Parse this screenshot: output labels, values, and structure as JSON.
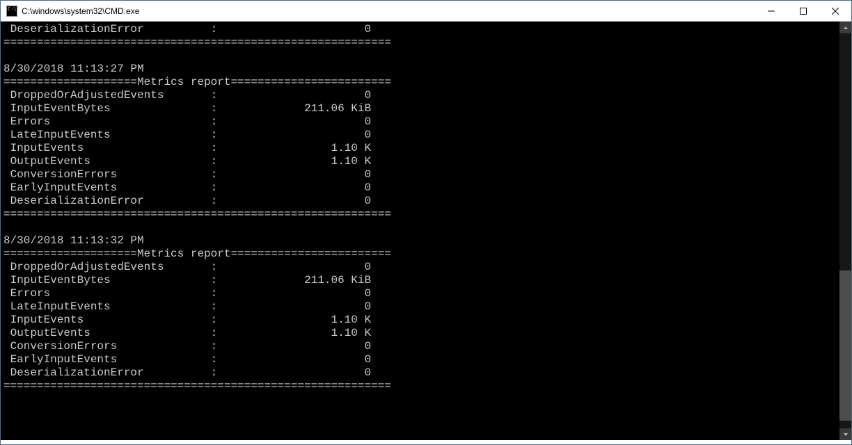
{
  "window": {
    "title": "C:\\windows\\system32\\CMD.exe"
  },
  "separator_heavy": "==========================================================",
  "report_header": "====================Metrics report========================",
  "top_fragment": {
    "label": "DeserializationError",
    "value": "0"
  },
  "reports": [
    {
      "timestamp": "8/30/2018 11:13:27 PM",
      "rows": [
        {
          "label": "DroppedOrAdjustedEvents",
          "value": "0"
        },
        {
          "label": "InputEventBytes",
          "value": "211.06 KiB"
        },
        {
          "label": "Errors",
          "value": "0"
        },
        {
          "label": "LateInputEvents",
          "value": "0"
        },
        {
          "label": "InputEvents",
          "value": "1.10 K"
        },
        {
          "label": "OutputEvents",
          "value": "1.10 K"
        },
        {
          "label": "ConversionErrors",
          "value": "0"
        },
        {
          "label": "EarlyInputEvents",
          "value": "0"
        },
        {
          "label": "DeserializationError",
          "value": "0"
        }
      ]
    },
    {
      "timestamp": "8/30/2018 11:13:32 PM",
      "rows": [
        {
          "label": "DroppedOrAdjustedEvents",
          "value": "0"
        },
        {
          "label": "InputEventBytes",
          "value": "211.06 KiB"
        },
        {
          "label": "Errors",
          "value": "0"
        },
        {
          "label": "LateInputEvents",
          "value": "0"
        },
        {
          "label": "InputEvents",
          "value": "1.10 K"
        },
        {
          "label": "OutputEvents",
          "value": "1.10 K"
        },
        {
          "label": "ConversionErrors",
          "value": "0"
        },
        {
          "label": "EarlyInputEvents",
          "value": "0"
        },
        {
          "label": "DeserializationError",
          "value": "0"
        }
      ]
    }
  ],
  "format": {
    "label_width": 30,
    "value_width": 22
  }
}
